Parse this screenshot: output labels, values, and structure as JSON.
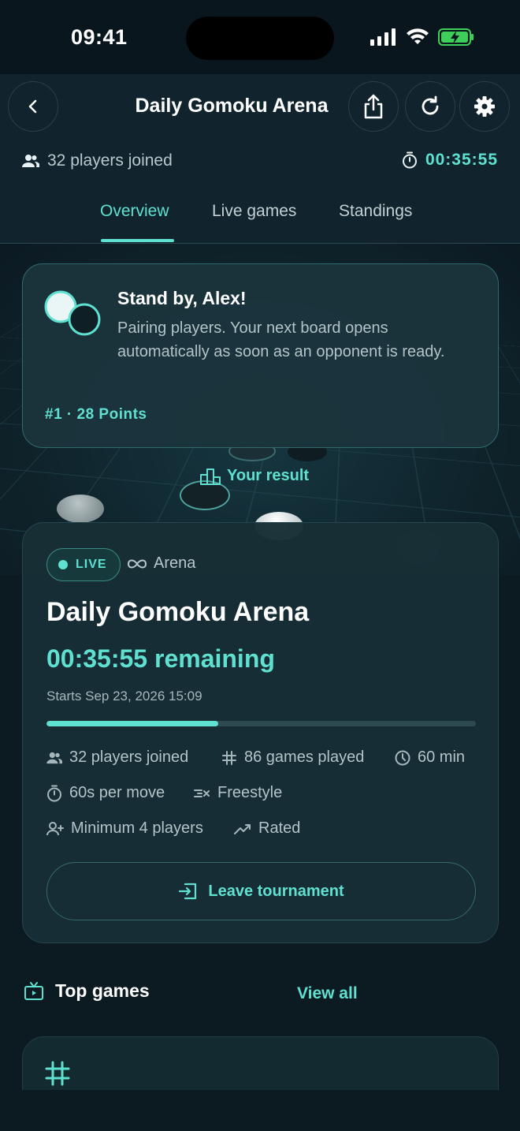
{
  "status_bar": {
    "time": "09:41"
  },
  "header": {
    "title": "Daily Gomoku Arena",
    "players_joined": "32 players joined",
    "timer": "00:35:55",
    "tabs": [
      {
        "label": "Overview",
        "active": true
      },
      {
        "label": "Live games",
        "active": false
      },
      {
        "label": "Standings",
        "active": false
      }
    ]
  },
  "standby": {
    "title": "Stand by, Alex!",
    "message": "Pairing players. Your next board opens automatically as soon as an opponent is ready.",
    "rank": "#1 · 28 Points"
  },
  "your_result_label": "Your result",
  "tournament": {
    "live_label": "LIVE",
    "type": "Arena",
    "title": "Daily Gomoku Arena",
    "remaining": "00:35:55 remaining",
    "starts": "Starts Sep 23, 2026 15:09",
    "progress": 0.4,
    "meta": {
      "players": "32 players joined",
      "games_played": "86 games played",
      "duration": "60 min",
      "per_move": "60s per move",
      "rule": "Freestyle",
      "minimum": "Minimum 4 players",
      "rated": "Rated"
    },
    "leave_label": "Leave tournament"
  },
  "top_games": {
    "title": "Top games",
    "view_all": "View all"
  },
  "colors": {
    "accent": "#5fe0d0",
    "background": "#0c1a22",
    "card": "#182e36"
  }
}
